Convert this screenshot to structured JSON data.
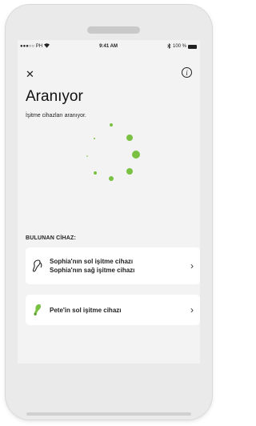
{
  "status_bar": {
    "carrier": "●●●○○ PH",
    "time": "9:41 AM",
    "battery": "100 %"
  },
  "header": {
    "close_icon": "close-icon",
    "info_icon": "info-icon"
  },
  "page": {
    "title": "Aranıyor",
    "subtitle": "İşitme cihazları aranıyor."
  },
  "found_section": {
    "label": "BULUNAN CİHAZ:",
    "devices": [
      {
        "icon": "hearing-aid-outline-icon",
        "line1": "Sophia'nın sol işitme cihazı",
        "line2": "Sophia'nın sağ işitme cihazı"
      },
      {
        "icon": "hearing-aid-green-icon",
        "line1": "Pete'in sol işitme cihazı"
      }
    ]
  },
  "colors": {
    "accent": "#7ac142",
    "card": "#ffffff",
    "screen_bg": "#f3f3f3"
  }
}
